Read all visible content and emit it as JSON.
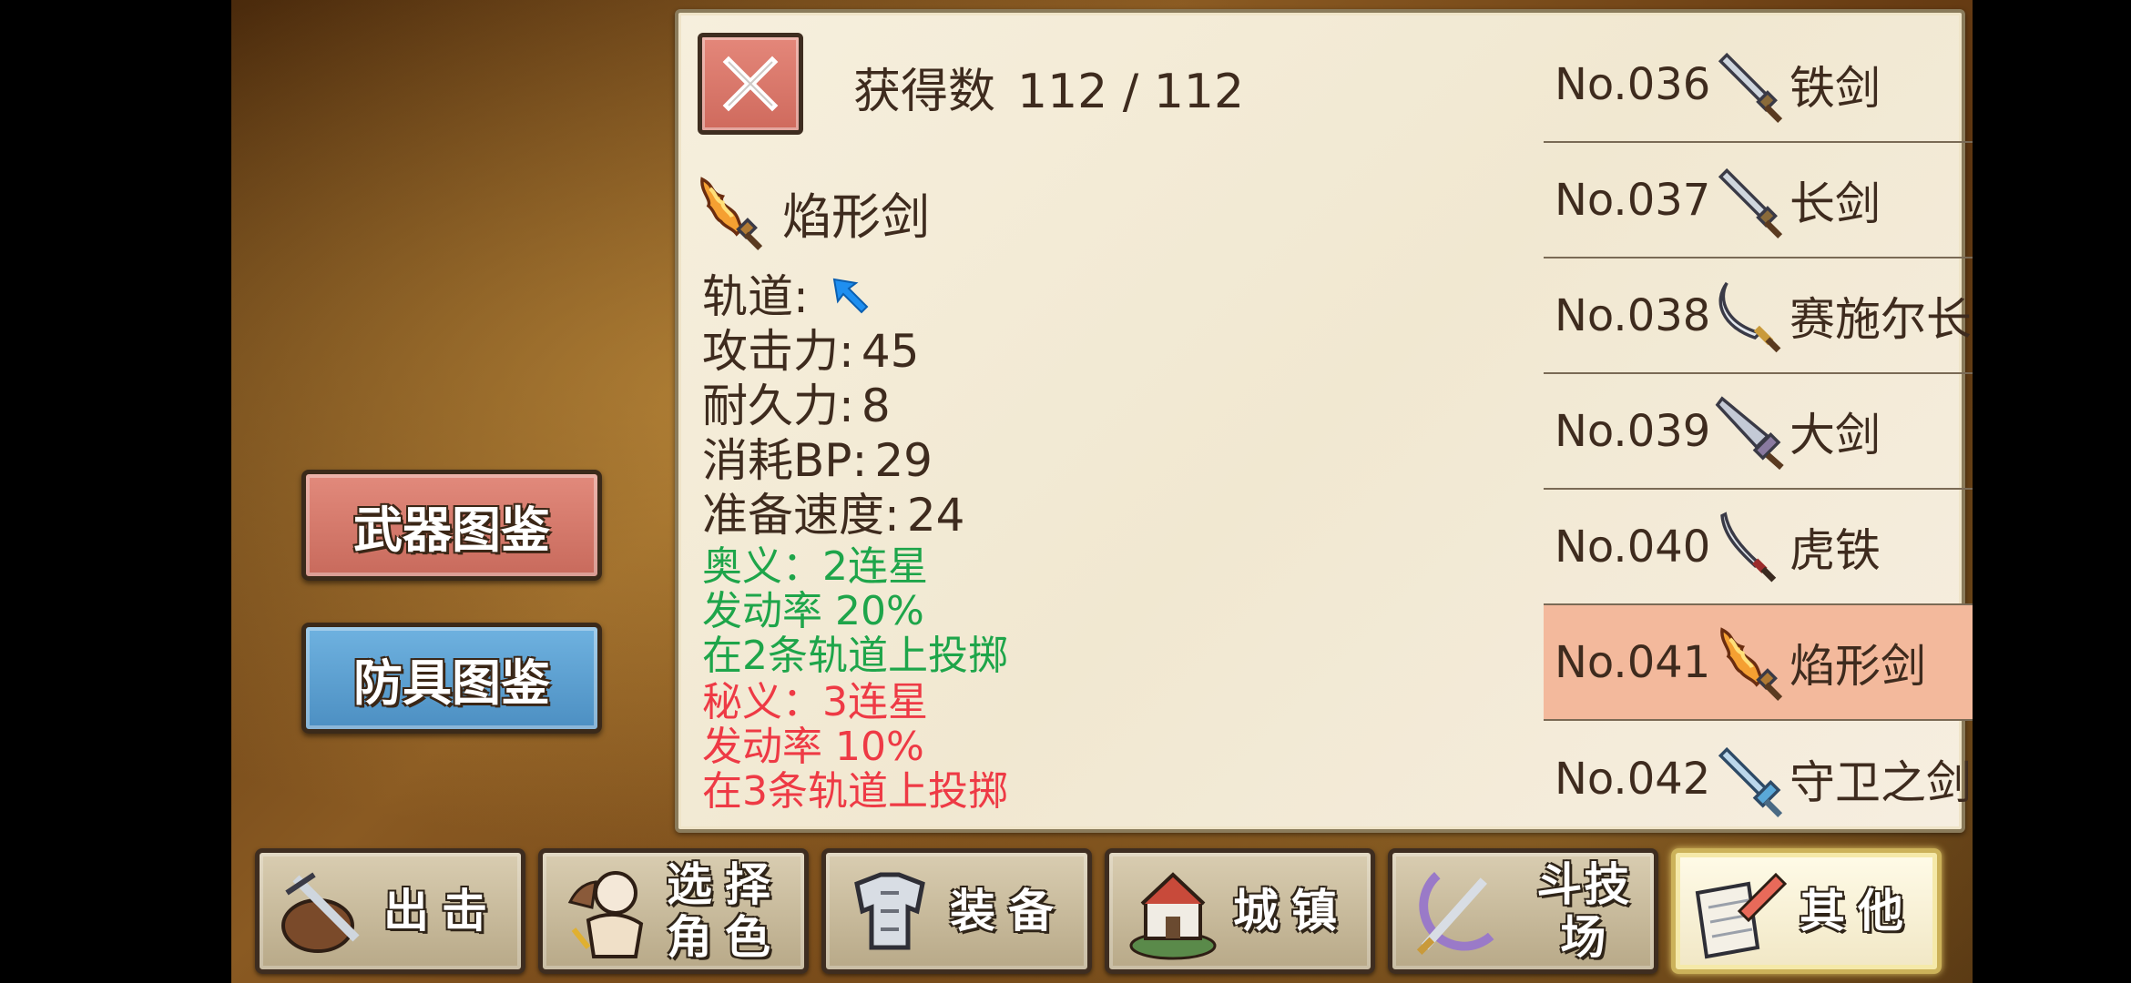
{
  "sidebar": {
    "weapons_label": "武器图鉴",
    "armor_label": "防具图鉴"
  },
  "header": {
    "count_label": "获得数",
    "count_value": "112 / 112"
  },
  "detail": {
    "name": "焰形剑",
    "orbit_label": "轨道:",
    "attack_label": "攻击力:",
    "attack_value": "45",
    "durability_label": "耐久力:",
    "durability_value": "8",
    "bp_label": "消耗BP:",
    "bp_value": "29",
    "speed_label": "准备速度:",
    "speed_value": "24",
    "skill1": {
      "title": "奥义：2连星",
      "rate": "发动率 20%",
      "desc": "在2条轨道上投掷"
    },
    "skill2": {
      "title": "秘义：3连星",
      "rate": "发动率 10%",
      "desc": "在3条轨道上投掷"
    }
  },
  "weapon_list": [
    {
      "no": "No.036",
      "name": "铁剑",
      "icon": "iron-sword-icon"
    },
    {
      "no": "No.037",
      "name": "长剑",
      "icon": "long-sword-icon"
    },
    {
      "no": "No.038",
      "name": "赛施尔长刀",
      "icon": "scimitar-icon"
    },
    {
      "no": "No.039",
      "name": "大剑",
      "icon": "great-sword-icon"
    },
    {
      "no": "No.040",
      "name": "虎铁",
      "icon": "katana-icon"
    },
    {
      "no": "No.041",
      "name": "焰形剑",
      "icon": "flame-sword-icon"
    },
    {
      "no": "No.042",
      "name": "守卫之剑",
      "icon": "guardian-sword-icon"
    }
  ],
  "bottom_tabs": [
    {
      "label": "出击",
      "icon": "sortie-icon"
    },
    {
      "label": "选择",
      "label2": "角色",
      "icon": "character-icon"
    },
    {
      "label": "装备",
      "icon": "armor-icon"
    },
    {
      "label": "城镇",
      "icon": "town-icon"
    },
    {
      "label": "斗技场",
      "icon": "arena-icon"
    },
    {
      "label": "其他",
      "icon": "other-icon"
    }
  ],
  "colors": {
    "selected_row": "#f3b99c",
    "skill_green": "#1ea54a",
    "skill_red": "#ee3a45",
    "weapons_button": "#e28a7c",
    "armor_button": "#6fb2e0"
  }
}
